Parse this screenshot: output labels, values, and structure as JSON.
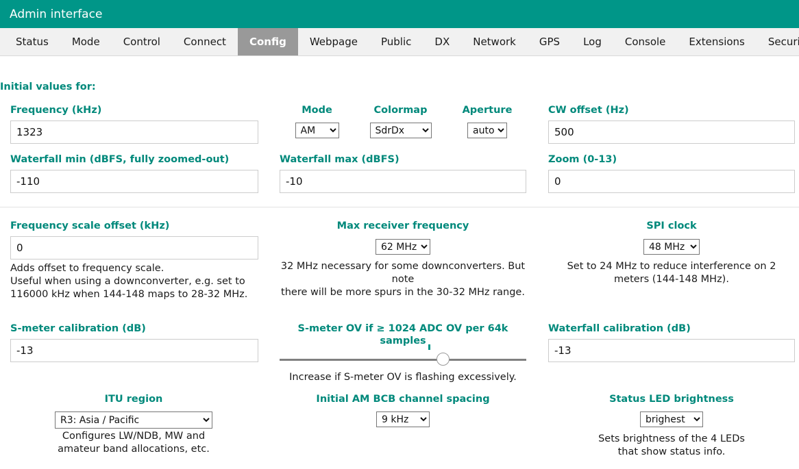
{
  "header": {
    "title": "Admin interface"
  },
  "tabs": [
    {
      "label": "Status",
      "active": false
    },
    {
      "label": "Mode",
      "active": false
    },
    {
      "label": "Control",
      "active": false
    },
    {
      "label": "Connect",
      "active": false
    },
    {
      "label": "Config",
      "active": true
    },
    {
      "label": "Webpage",
      "active": false
    },
    {
      "label": "Public",
      "active": false
    },
    {
      "label": "DX",
      "active": false
    },
    {
      "label": "Network",
      "active": false
    },
    {
      "label": "GPS",
      "active": false
    },
    {
      "label": "Log",
      "active": false
    },
    {
      "label": "Console",
      "active": false
    },
    {
      "label": "Extensions",
      "active": false
    },
    {
      "label": "Security",
      "active": false
    }
  ],
  "section_heading": "Initial values for:",
  "fields": {
    "frequency": {
      "label": "Frequency (kHz)",
      "value": "1323"
    },
    "mode": {
      "label": "Mode",
      "value": "AM"
    },
    "colormap": {
      "label": "Colormap",
      "value": "SdrDx"
    },
    "aperture": {
      "label": "Aperture",
      "value": "auto"
    },
    "cw_offset": {
      "label": "CW offset (Hz)",
      "value": "500"
    },
    "waterfall_min": {
      "label": "Waterfall min (dBFS, fully zoomed-out)",
      "value": "-110"
    },
    "waterfall_max": {
      "label": "Waterfall max (dBFS)",
      "value": "-10"
    },
    "zoom": {
      "label": "Zoom (0-13)",
      "value": "0"
    },
    "freq_scale_offset": {
      "label": "Frequency scale offset (kHz)",
      "value": "0",
      "hint": "Adds offset to frequency scale.\nUseful when using a downconverter, e.g. set to 116000 kHz when 144-148 maps to 28-32 MHz."
    },
    "max_rx_freq": {
      "label": "Max receiver frequency",
      "value": "62 MHz",
      "hint_line1": "32 MHz necessary for some downconverters. But note",
      "hint_line2": "there will be more spurs in the 30-32 MHz range."
    },
    "spi_clock": {
      "label": "SPI clock",
      "value": "48 MHz",
      "hint": "Set to 24 MHz to reduce interference on 2 meters (144-148 MHz)."
    },
    "smeter_cal": {
      "label": "S-meter calibration (dB)",
      "value": "-13"
    },
    "smeter_ov": {
      "label": "S-meter OV if ≥ 1024 ADC OV per 64k samples",
      "hint": "Increase if S-meter OV is flashing excessively.",
      "slider_percent": 66
    },
    "waterfall_cal": {
      "label": "Waterfall calibration (dB)",
      "value": "-13"
    },
    "itu_region": {
      "label": "ITU region",
      "value": "R3: Asia / Pacific",
      "hint": "Configures LW/NDB, MW and amateur band allocations, etc."
    },
    "am_bcb_spacing": {
      "label": "Initial AM BCB channel spacing",
      "value": "9 kHz"
    },
    "status_led": {
      "label": "Status LED brightness",
      "value": "brighest",
      "hint": "Sets brightness of the 4 LEDs that show status info."
    }
  },
  "colors": {
    "header_teal": "#009688",
    "label_teal": "#00897b",
    "active_tab": "#999999",
    "tabbar_bg": "#f1f1f1"
  }
}
